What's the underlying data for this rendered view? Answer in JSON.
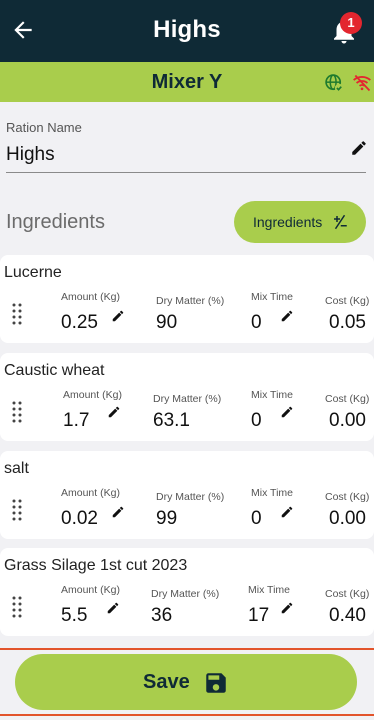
{
  "header": {
    "title": "Highs",
    "back_icon": "arrow-left-icon",
    "notifications_icon": "bell-icon",
    "notification_count": "1"
  },
  "mixer_bar": {
    "name": "Mixer Y",
    "status_icons": [
      "globe-check-icon",
      "wifi-off-icon"
    ]
  },
  "ration": {
    "label": "Ration Name",
    "value": "Highs",
    "edit_icon": "pencil-icon"
  },
  "ingredients_section": {
    "title": "Ingredients",
    "button_label": "Ingredients",
    "button_icon": "plus-minus-icon"
  },
  "ingredients": [
    {
      "name": "Lucerne",
      "amount_label": "Amount (Kg)",
      "amount": "0.25",
      "dry_matter_label": "Dry Matter (%)",
      "dry_matter": "90",
      "mix_time_label": "Mix Time",
      "mix_time": "0",
      "cost_label": "Cost (Kg)",
      "cost": "0.05"
    },
    {
      "name": "Caustic wheat",
      "amount_label": "Amount (Kg)",
      "amount": "1.7",
      "dry_matter_label": "Dry Matter (%)",
      "dry_matter": "63.1",
      "mix_time_label": "Mix Time",
      "mix_time": "0",
      "cost_label": "Cost (Kg)",
      "cost": "0.00"
    },
    {
      "name": "salt",
      "amount_label": "Amount (Kg)",
      "amount": "0.02",
      "dry_matter_label": "Dry Matter (%)",
      "dry_matter": "99",
      "mix_time_label": "Mix Time",
      "mix_time": "0",
      "cost_label": "Cost (Kg)",
      "cost": "0.00"
    },
    {
      "name": "Grass Silage 1st cut 2023",
      "amount_label": "Amount (Kg)",
      "amount": "5.5",
      "dry_matter_label": "Dry Matter (%)",
      "dry_matter": "36",
      "mix_time_label": "Mix Time",
      "mix_time": "17",
      "cost_label": "Cost (Kg)",
      "cost": "0.40"
    }
  ],
  "footer": {
    "save_label": "Save",
    "save_icon": "floppy-disk-icon"
  },
  "colors": {
    "header_bg": "#0f2a36",
    "accent_green": "#a9cd4c",
    "badge_red": "#e3262f",
    "divider_orange": "#e2542b",
    "globe_green": "#1e7a2e"
  }
}
